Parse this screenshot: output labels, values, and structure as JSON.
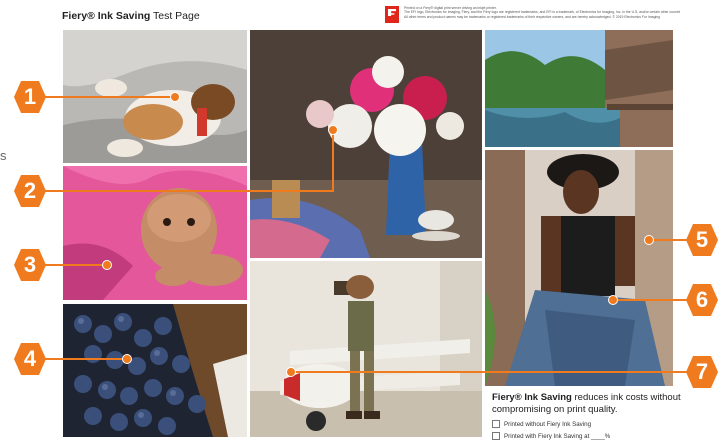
{
  "header": {
    "title_brand": "Fiery® Ink Saving",
    "title_rest": " Test Page",
    "fine_print": [
      "Printed on a Fiery® digital print server driving an inkjet printer.",
      "The EFI logo, Electronics for Imaging, Fiery, and the Fiery logo are registered trademarks, and EFI is a trademark, of Electronics for Imaging, Inc. in the U.S. and/or certain other countries.",
      "All other terms and product names may be trademarks or registered trademarks of their respective owners, and are hereby acknowledged. © 2019 Electronics For Imaging"
    ]
  },
  "side_text": "s",
  "callouts": [
    "1",
    "2",
    "3",
    "4",
    "5",
    "6",
    "7"
  ],
  "colors": {
    "accent": "#f07a1e",
    "logo": "#e0261b"
  },
  "photos": [
    "puppy",
    "flowers",
    "pool",
    "baby",
    "woman",
    "blueberries",
    "boy-airplane"
  ],
  "info": {
    "brand": "Fiery® Ink Saving",
    "text": " reduces ink costs without compromising on print quality.",
    "options": [
      "Printed without Fiery Ink Saving",
      "Printed with Fiery Ink Saving at ____%"
    ]
  }
}
